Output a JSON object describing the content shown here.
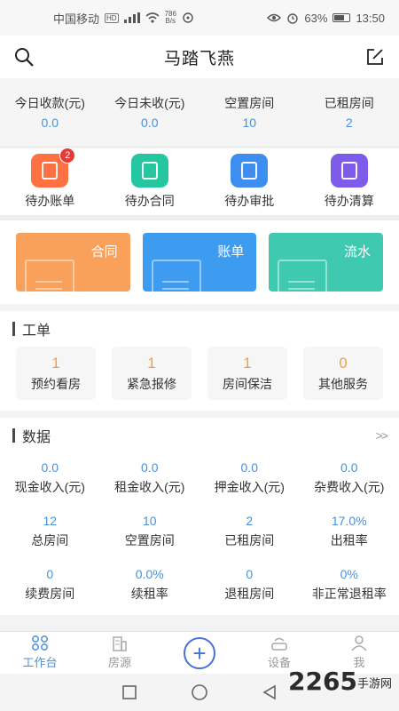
{
  "statusbar": {
    "carrier": "中国移动",
    "hd": "HD",
    "speed_value": "786",
    "speed_unit": "B/s",
    "battery": "63%",
    "time": "13:50"
  },
  "header": {
    "title": "马踏飞燕"
  },
  "stats": [
    {
      "label": "今日收款(元)",
      "value": "0.0"
    },
    {
      "label": "今日未收(元)",
      "value": "0.0"
    },
    {
      "label": "空置房间",
      "value": "10"
    },
    {
      "label": "已租房间",
      "value": "2"
    }
  ],
  "todo": [
    {
      "label": "待办账单",
      "badge": "2",
      "color": "#ff7043"
    },
    {
      "label": "待办合同",
      "color": "#26c6a0"
    },
    {
      "label": "待办审批",
      "color": "#3d8ef0"
    },
    {
      "label": "待办清算",
      "color": "#7e5be8"
    }
  ],
  "cards": [
    {
      "label": "合同",
      "color": "#f9a05a"
    },
    {
      "label": "账单",
      "color": "#3d9cf0"
    },
    {
      "label": "流水",
      "color": "#3ec9b0"
    }
  ],
  "workorder": {
    "title": "工单",
    "items": [
      {
        "count": "1",
        "label": "预约看房"
      },
      {
        "count": "1",
        "label": "紧急报修"
      },
      {
        "count": "1",
        "label": "房间保洁"
      },
      {
        "count": "0",
        "label": "其他服务"
      }
    ]
  },
  "data": {
    "title": "数据",
    "more": ">>",
    "items": [
      {
        "value": "0.0",
        "label": "现金收入(元)"
      },
      {
        "value": "0.0",
        "label": "租金收入(元)"
      },
      {
        "value": "0.0",
        "label": "押金收入(元)"
      },
      {
        "value": "0.0",
        "label": "杂费收入(元)"
      },
      {
        "value": "12",
        "label": "总房间"
      },
      {
        "value": "10",
        "label": "空置房间"
      },
      {
        "value": "2",
        "label": "已租房间"
      },
      {
        "value": "17.0%",
        "label": "出租率"
      },
      {
        "value": "0",
        "label": "续费房间"
      },
      {
        "value": "0.0%",
        "label": "续租率"
      },
      {
        "value": "0",
        "label": "退租房间"
      },
      {
        "value": "0%",
        "label": "非正常退租率"
      }
    ]
  },
  "tabbar": {
    "tab1": "工作台",
    "tab2": "房源",
    "tab4": "设备",
    "tab5": "我"
  },
  "watermark": {
    "text": "2265",
    "sub": "手游网"
  }
}
